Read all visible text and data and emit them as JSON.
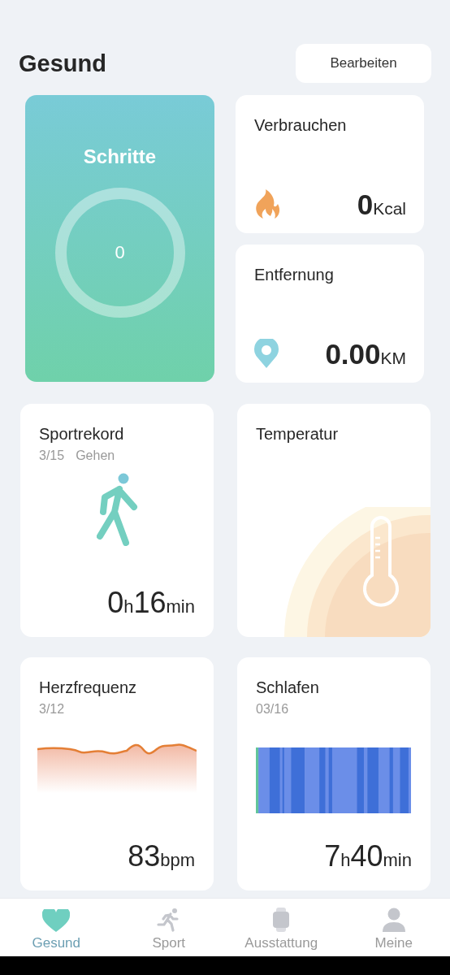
{
  "header": {
    "title": "Gesund",
    "edit_button": "Bearbeiten"
  },
  "steps": {
    "title": "Schritte",
    "value": "0"
  },
  "calories": {
    "title": "Verbrauchen",
    "value": "0",
    "unit": "Kcal"
  },
  "distance": {
    "title": "Entfernung",
    "value": "0.00",
    "unit": "KM"
  },
  "sport_record": {
    "title": "Sportrekord",
    "date": "3/15",
    "activity": "Gehen",
    "value": [
      {
        "text": "0",
        "kind": "number"
      },
      {
        "text": "h",
        "kind": "unit"
      },
      {
        "text": "16",
        "kind": "number"
      },
      {
        "text": "min",
        "kind": "unit"
      }
    ]
  },
  "temperature": {
    "title": "Temperatur"
  },
  "heart_rate": {
    "title": "Herzfrequenz",
    "date": "3/12",
    "value": [
      {
        "text": "83",
        "kind": "number"
      },
      {
        "text": "bpm",
        "kind": "unit"
      }
    ]
  },
  "sleep": {
    "title": "Schlafen",
    "date": "03/16",
    "value": [
      {
        "text": "7",
        "kind": "number"
      },
      {
        "text": "h",
        "kind": "unit"
      },
      {
        "text": "40",
        "kind": "number"
      },
      {
        "text": "min",
        "kind": "unit"
      }
    ]
  },
  "tabs": [
    {
      "label": "Gesund",
      "kind": "heart",
      "selected": true
    },
    {
      "label": "Sport",
      "kind": "runner",
      "selected": false
    },
    {
      "label": "Ausstattung",
      "kind": "watch",
      "selected": false
    },
    {
      "label": "Meine",
      "kind": "person",
      "selected": false
    }
  ]
}
